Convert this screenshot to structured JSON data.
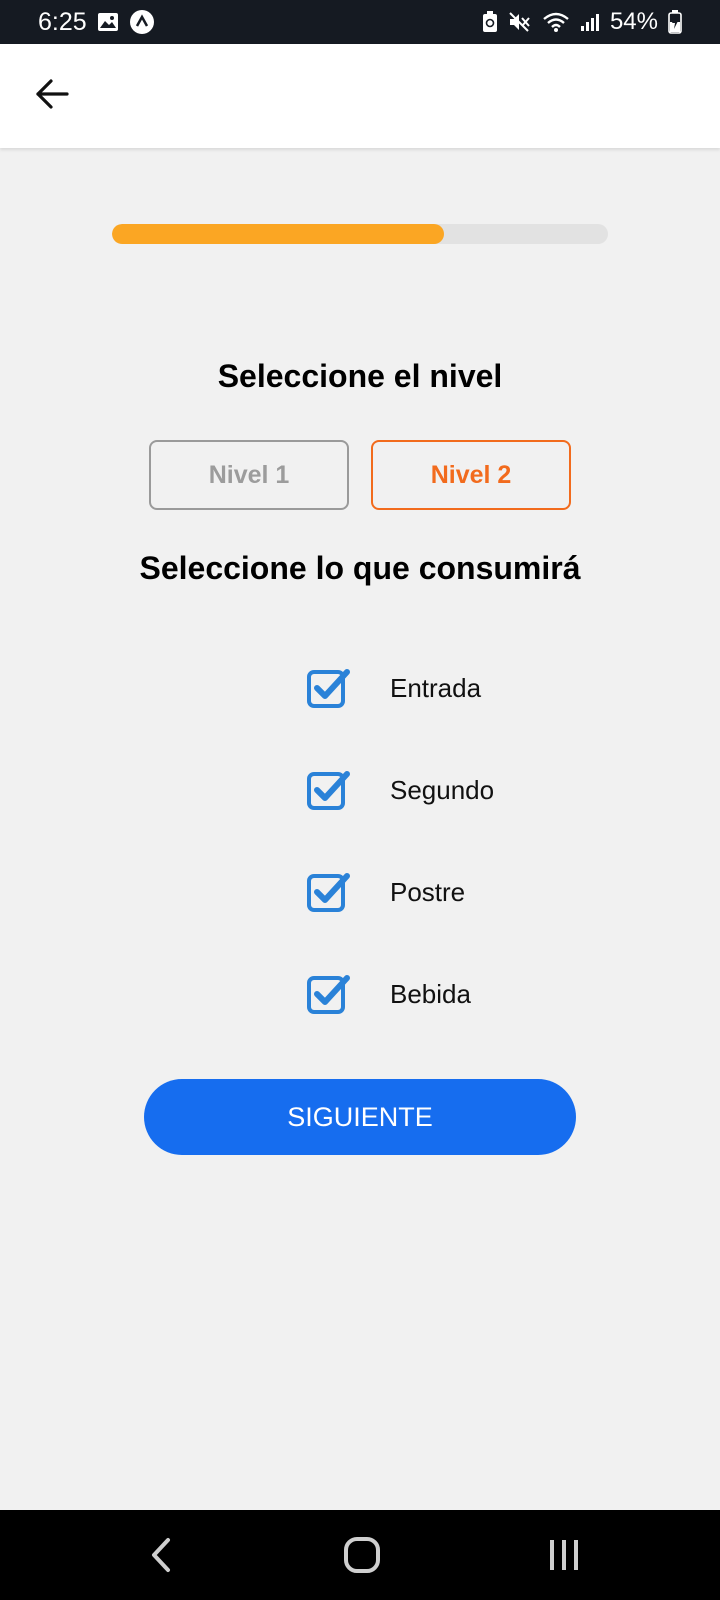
{
  "status_bar": {
    "time": "6:25",
    "battery": "54%",
    "icons": [
      "image-icon",
      "app-notification-icon",
      "battery-saver-icon",
      "mute-icon",
      "wifi-icon",
      "signal-icon",
      "battery-charging-icon"
    ]
  },
  "app_bar": {
    "back_icon": "arrow-back-icon"
  },
  "progress": {
    "value_percent": 67,
    "color": "#fba623",
    "track_color": "#e2e2e2"
  },
  "level_section": {
    "title": "Seleccione el nivel",
    "options": [
      {
        "label": "Nivel 1",
        "selected": false
      },
      {
        "label": "Nivel 2",
        "selected": true
      }
    ],
    "selected_color": "#f26b1d"
  },
  "consume_section": {
    "title": "Seleccione lo que consumirá",
    "items": [
      {
        "label": "Entrada",
        "checked": true
      },
      {
        "label": "Segundo",
        "checked": true
      },
      {
        "label": "Postre",
        "checked": true
      },
      {
        "label": "Bebida",
        "checked": true
      }
    ],
    "checkbox_color": "#2a82d8"
  },
  "next_button": {
    "label": "SIGUIENTE",
    "color": "#166def"
  },
  "nav_bar": {
    "items": [
      "back-nav-icon",
      "home-nav-icon",
      "recents-nav-icon"
    ]
  }
}
